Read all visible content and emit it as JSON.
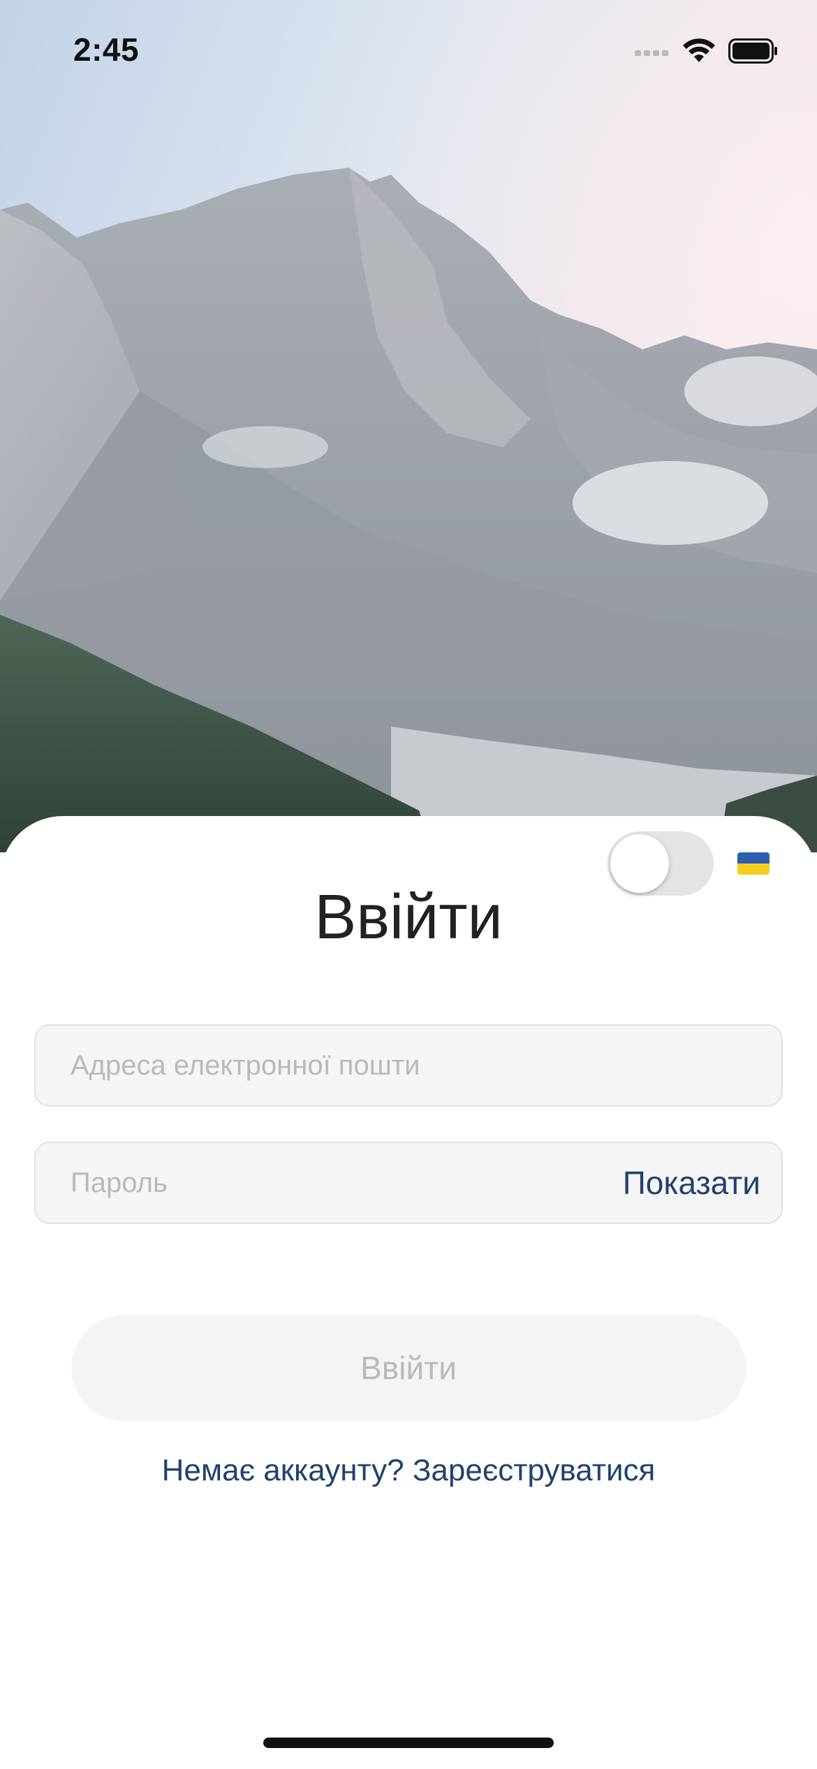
{
  "status_bar": {
    "time": "2:45"
  },
  "hero": {
    "icon": "mountain-landscape-image"
  },
  "language": {
    "toggle_on": false,
    "flag_icon": "ukraine-flag-icon",
    "flag_colors": [
      "#2d5fb0",
      "#f5cf1d"
    ]
  },
  "login": {
    "title": "Ввійти",
    "email_placeholder": "Адреса електронної пошти",
    "password_placeholder": "Пароль",
    "show_password_label": "Показати",
    "submit_label": "Ввійти",
    "signup_link": "Немає аккаунту? Зареєструватися"
  },
  "colors": {
    "accent": "#1f426e",
    "button_bg": "#f4f4f4",
    "button_text_disabled": "#b9b9b9",
    "field_bg": "#f5f5f5"
  }
}
